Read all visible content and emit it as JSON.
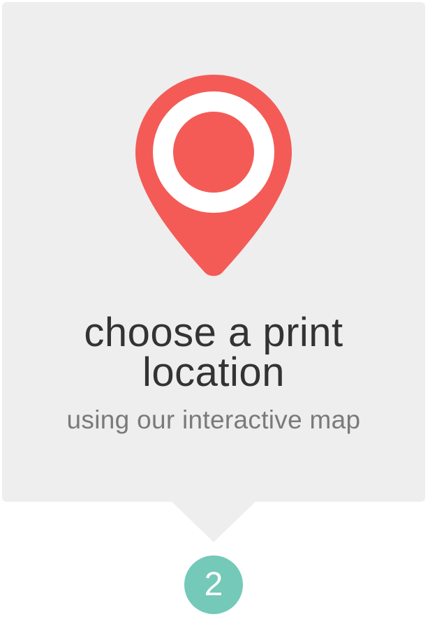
{
  "card": {
    "title_line1": "choose a print",
    "title_line2": "location",
    "subtitle": "using our interactive map"
  },
  "pin": {
    "icon": "map-pin-icon",
    "color": "#f45b57"
  },
  "step": {
    "number": "2",
    "color": "#75c9b9"
  },
  "colors": {
    "card_background": "#eeeeee",
    "title_text": "#333333",
    "subtitle_text": "#7a7a7a"
  }
}
